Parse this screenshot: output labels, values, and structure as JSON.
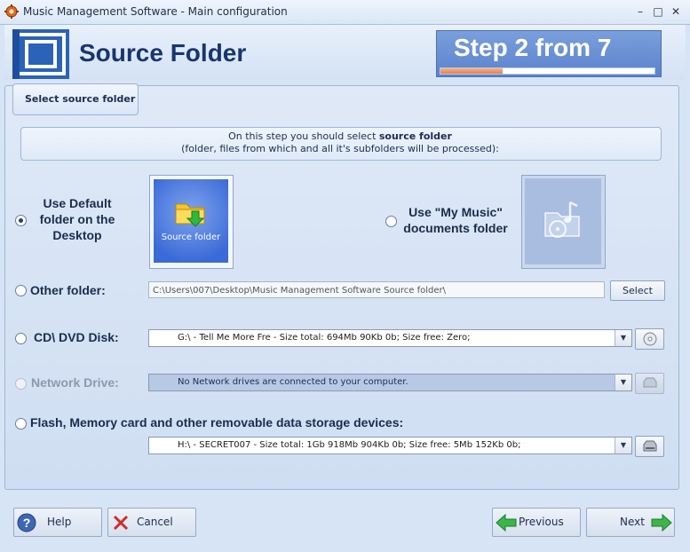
{
  "window": {
    "title": "Music Management Software - Main configuration",
    "minimize_glyph": "–",
    "maximize_glyph": "□",
    "close_glyph": "✕"
  },
  "header": {
    "title": "Source Folder",
    "step_text": "Step 2 from 7",
    "step_progress": 0.29
  },
  "tab": {
    "label": "Select source folder"
  },
  "info": {
    "line1_prefix": "On this step you should select ",
    "line1_bold": "source folder",
    "line2": "(folder, files from which and all it's subfolders will be processed):"
  },
  "options": {
    "default_desktop": {
      "line1": "Use Default",
      "line2": "folder on the",
      "line3": "Desktop",
      "checked": true,
      "tile_label": "Source folder"
    },
    "my_music": {
      "line1": "Use \"My Music\"",
      "line2": "documents folder",
      "checked": false
    },
    "other_folder": {
      "label": "Other folder:",
      "path": "C:\\Users\\007\\Desktop\\Music Management Software Source folder\\",
      "select_label": "Select"
    },
    "cd_dvd": {
      "label": "CD\\ DVD Disk:",
      "value": "G:\\ - Tell Me More Fre - Size total: 694Mb 90Kb 0b;  Size free: Zero;"
    },
    "network": {
      "label": "Network Drive:",
      "value": "No Network drives are connected to your computer."
    },
    "flash": {
      "label": "Flash, Memory card and other removable data storage devices:",
      "value": "H:\\ - SECRET007 - Size total: 1Gb 918Mb 904Kb 0b;  Size free: 5Mb 152Kb 0b;"
    }
  },
  "footer": {
    "help": "Help",
    "cancel": "Cancel",
    "previous": "Previous",
    "next": "Next"
  },
  "colors": {
    "accent": "#18366e",
    "step_box": "#5b83cd",
    "panel": "#d6e4f5"
  }
}
